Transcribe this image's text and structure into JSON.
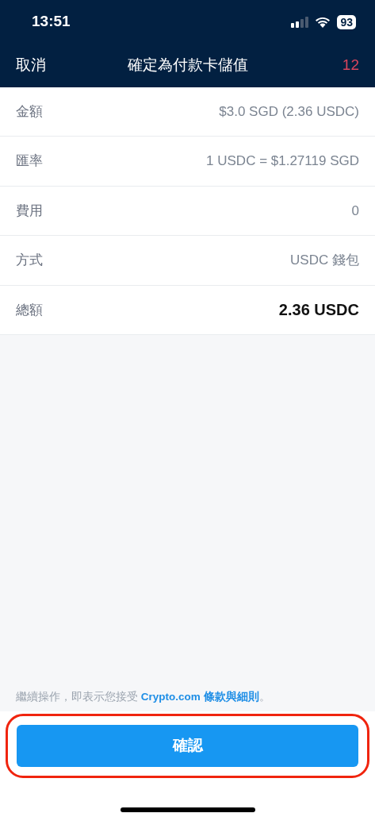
{
  "status_bar": {
    "time": "13:51",
    "battery": "93"
  },
  "nav_bar": {
    "cancel": "取消",
    "title": "確定為付款卡儲值",
    "countdown": "12"
  },
  "details": [
    {
      "label": "金額",
      "value": "$3.0 SGD (2.36 USDC)",
      "kind": "normal"
    },
    {
      "label": "匯率",
      "value": "1 USDC = $1.27119 SGD",
      "kind": "normal"
    },
    {
      "label": "費用",
      "value": "0",
      "kind": "normal"
    },
    {
      "label": "方式",
      "value": "USDC 錢包",
      "kind": "normal"
    },
    {
      "label": "總額",
      "value": "2.36 USDC",
      "kind": "total"
    }
  ],
  "terms": {
    "before": "繼續操作，即表示您接受 ",
    "link": "Crypto.com 條款與細則",
    "after": "。"
  },
  "confirm_button": {
    "label": "確認",
    "highlighted": true
  }
}
